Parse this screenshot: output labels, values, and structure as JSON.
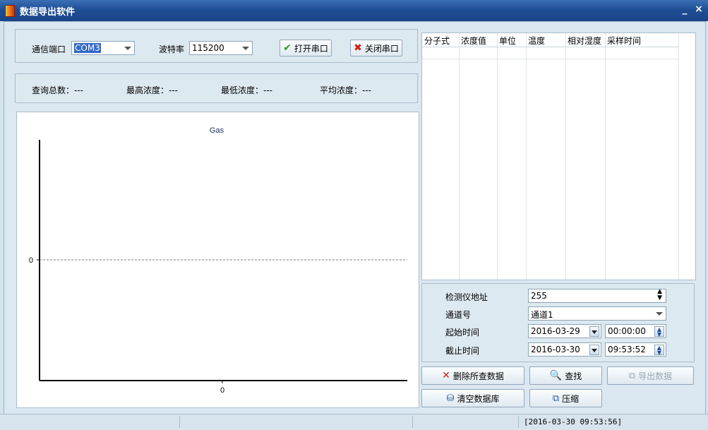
{
  "window": {
    "title": "数据导出软件",
    "minimize": "_",
    "close": "×"
  },
  "serial": {
    "port_label": "通信端口",
    "port_value": "COM3",
    "baud_label": "波特率",
    "baud_value": "115200",
    "open_button": "打开串口",
    "close_button": "关闭串口"
  },
  "stats": {
    "total": "查询总数：---",
    "max": "最高浓度：---",
    "min": "最低浓度：---",
    "avg": "平均浓度：---"
  },
  "chart_data": {
    "type": "line",
    "title": "Gas",
    "x_ticks": [
      "0"
    ],
    "y_ticks": [
      "0"
    ],
    "series": [],
    "zero_line": "dashed"
  },
  "table": {
    "columns": [
      "分子式",
      "浓度值",
      "单位",
      "温度",
      "相对湿度",
      "采样时间"
    ],
    "rows": []
  },
  "query": {
    "address_label": "检测仪地址",
    "address_value": "255",
    "channel_label": "通道号",
    "channel_value": "通道1",
    "start_label": "起始时间",
    "start_date": "2016-03-29",
    "start_time": "00:00:00",
    "end_label": "截止时间",
    "end_date": "2016-03-30",
    "end_time": "09:53:52"
  },
  "actions": {
    "delete": "删除所查数据",
    "find": "查找",
    "export": "导出数据",
    "clear": "清空数据库",
    "compress": "压缩"
  },
  "statusbar": {
    "time": "[2016-03-30 09:53:56]"
  },
  "colors": {
    "title_bar": "#1f4e95",
    "delete_icon": "#d02020",
    "check_icon": "#2a9a2a"
  }
}
